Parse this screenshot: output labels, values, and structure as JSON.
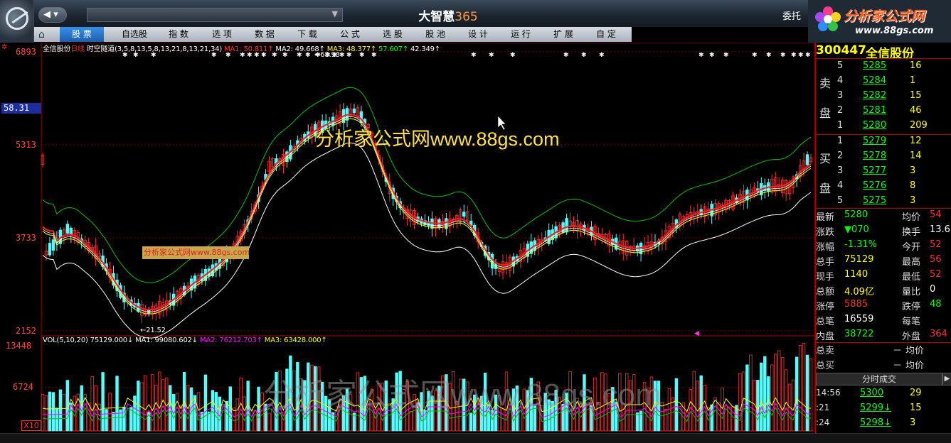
{
  "window": {
    "title_main": "大智慧",
    "title_num": "365",
    "back_label": "◀ ▾",
    "addr_arrow": "▼",
    "entrust": "委托"
  },
  "brand": {
    "name": "分析家公式网",
    "url": "www.88gs.com"
  },
  "menu": [
    "股 票",
    "自选股",
    "指 数",
    "选 项",
    "数 据",
    "下 载",
    "公 式",
    "选 股",
    "股 池",
    "设 计",
    "运 行",
    "扩 展",
    "自 定"
  ],
  "chart": {
    "status_line": [
      {
        "t": "全信股份",
        "c": "#ffffff"
      },
      {
        "t": "日线",
        "c": "#ff3030"
      },
      {
        "t": " 时空隧道(3,5,8,13,5,8,13,21,8,13,21,34)",
        "c": "#ffffff"
      },
      {
        "t": " MA1: 50.811↑",
        "c": "#ff3030"
      },
      {
        "t": " MA2: 49.668↑",
        "c": "#ffffff"
      },
      {
        "t": " MA3: 48.377↑",
        "c": "#ffff00"
      },
      {
        "t": " 57.607↑",
        "c": "#00ff00"
      },
      {
        "t": " 42.349↑",
        "c": "#ffffff"
      }
    ],
    "y_labels": [
      "6893",
      "5313",
      "3733",
      "2152"
    ],
    "price_box": "58.31",
    "high_label": "←68.93",
    "low_label": "←21.52",
    "watermark_main": "分析家公式网www.88gs.com",
    "watermark_small": "分析家公式网www.88gs.com",
    "watermark_vol": "分析家公式网www.88gs.com",
    "vol_status": [
      {
        "t": "VOL(5,10,20) ",
        "c": "#ffffff"
      },
      {
        "t": "75129.000↓",
        "c": "#ffffff"
      },
      {
        "t": " MA1: 99080.602↓",
        "c": "#ffffff"
      },
      {
        "t": " MA2: 76212.703↑",
        "c": "#ff00ff"
      },
      {
        "t": " MA3: 63428.000↑",
        "c": "#ffff00"
      }
    ],
    "vol_labels": [
      "13448",
      "6724"
    ],
    "vol_unit": "X10"
  },
  "quote": {
    "code": "300447",
    "name": "全信股份",
    "sell_label": [
      "卖",
      "盘"
    ],
    "buy_label": [
      "买",
      "盘"
    ],
    "sells": [
      {
        "lvl": "5",
        "price": "5285",
        "vol": "16"
      },
      {
        "lvl": "4",
        "price": "5284",
        "vol": "1"
      },
      {
        "lvl": "3",
        "price": "5282",
        "vol": "15"
      },
      {
        "lvl": "2",
        "price": "5281",
        "vol": "46"
      },
      {
        "lvl": "1",
        "price": "5280",
        "vol": "209"
      }
    ],
    "buys": [
      {
        "lvl": "1",
        "price": "5279",
        "vol": "12"
      },
      {
        "lvl": "2",
        "price": "5278",
        "vol": "14"
      },
      {
        "lvl": "3",
        "price": "5277",
        "vol": "3"
      },
      {
        "lvl": "4",
        "price": "5276",
        "vol": "8"
      },
      {
        "lvl": "5",
        "price": "5275",
        "vol": "3"
      }
    ],
    "stats": [
      {
        "l1": "最新",
        "v1": "5280",
        "c1": "#00ff00",
        "l2": "均价",
        "v2": "54",
        "c2": "#ff3030"
      },
      {
        "l1": "涨跌",
        "v1": "▼070",
        "c1": "#00ff00",
        "l2": "换手",
        "v2": "13.6",
        "c2": "#ffffff"
      },
      {
        "l1": "涨幅",
        "v1": "-1.31%",
        "c1": "#00ff00",
        "l2": "今开",
        "v2": "52",
        "c2": "#ff3030"
      },
      {
        "l1": "总手",
        "v1": "75129",
        "c1": "#ffff00",
        "l2": "最高",
        "v2": "56",
        "c2": "#ff3030"
      },
      {
        "l1": "现手",
        "v1": "1140",
        "c1": "#ffff00",
        "l2": "最低",
        "v2": "52",
        "c2": "#ff3030"
      },
      {
        "l1": "总额",
        "v1": "4.09亿",
        "c1": "#ffff00",
        "l2": "量比",
        "v2": "0",
        "c2": "#ffffff"
      },
      {
        "l1": "涨停",
        "v1": "5885",
        "c1": "#ff3030",
        "l2": "跌停",
        "v2": "48",
        "c2": "#00ff00"
      },
      {
        "l1": "总笔",
        "v1": "16559",
        "c1": "#ffffff",
        "l2": "每笔",
        "v2": "",
        "c2": "#ffffff"
      },
      {
        "l1": "内盘",
        "v1": "38722",
        "c1": "#00ff00",
        "l2": "外盘",
        "v2": "364",
        "c2": "#ff3030"
      }
    ],
    "total_sell": {
      "label": "总卖",
      "val": "－",
      "avg": "均价"
    },
    "total_buy": {
      "label": "总买",
      "val": "－",
      "avg": "均价"
    },
    "tick_title": "分时成交",
    "ticks": [
      {
        "time": "14:56",
        "price": "5300",
        "vol": "29",
        "arrow": ""
      },
      {
        "time": ":21",
        "price": "5299",
        "vol": "15",
        "arrow": "↓"
      },
      {
        "time": ":24",
        "price": "5298",
        "vol": "3",
        "arrow": "↓"
      }
    ]
  }
}
